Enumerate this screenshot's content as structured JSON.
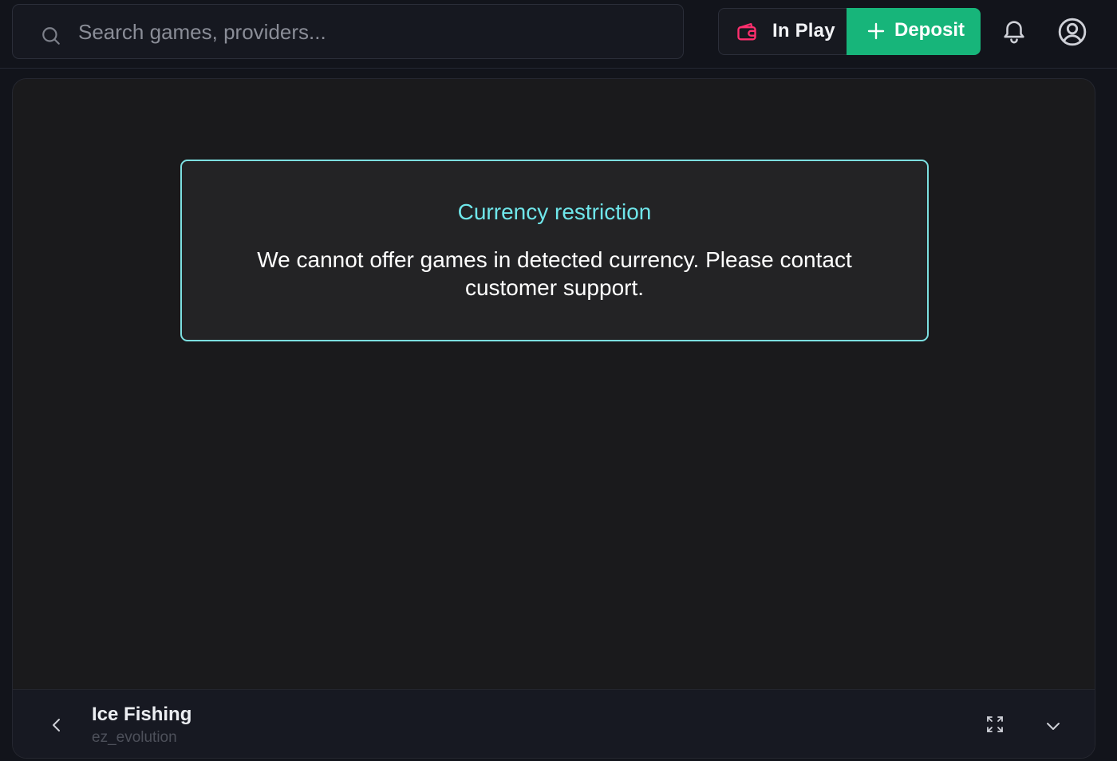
{
  "header": {
    "search": {
      "placeholder": "Search games, providers...",
      "value": ""
    },
    "in_play_label": "In Play",
    "deposit_label": "Deposit",
    "colors": {
      "deposit_bg": "#17b57a",
      "wallet_icon": "#ff2f6e"
    },
    "icons": [
      "search-icon",
      "wallet-icon",
      "plus-icon",
      "bell-icon",
      "user-circle-icon"
    ]
  },
  "dialog": {
    "title": "Currency restriction",
    "message": "We cannot offer games in detected currency. Please contact customer support.",
    "colors": {
      "title": "#6fe6ea",
      "border": "#7cdfe0"
    }
  },
  "game_bar": {
    "title": "Ice Fishing",
    "provider": "ez_evolution",
    "icons": [
      "chevron-left-icon",
      "fullscreen-icon",
      "chevron-down-icon"
    ]
  }
}
